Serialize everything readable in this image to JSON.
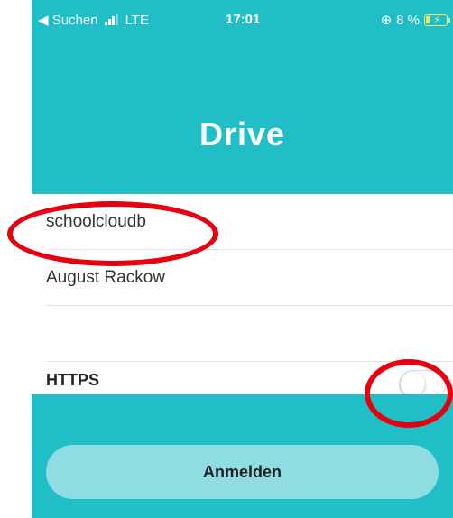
{
  "status_bar": {
    "back_label": "◀ Suchen",
    "network": "LTE",
    "time": "17:01",
    "battery": "8 %"
  },
  "header": {
    "title": "Drive"
  },
  "form": {
    "server_value": "schoolcloudb",
    "username_value": "August Rackow",
    "password_value": "",
    "https_label": "HTTPS",
    "https_enabled": false
  },
  "footer": {
    "login_label": "Anmelden"
  },
  "annotations": {
    "highlight_color": "#e8000f"
  },
  "colors": {
    "accent": "#20bfc7",
    "button": "#8fdde2"
  }
}
